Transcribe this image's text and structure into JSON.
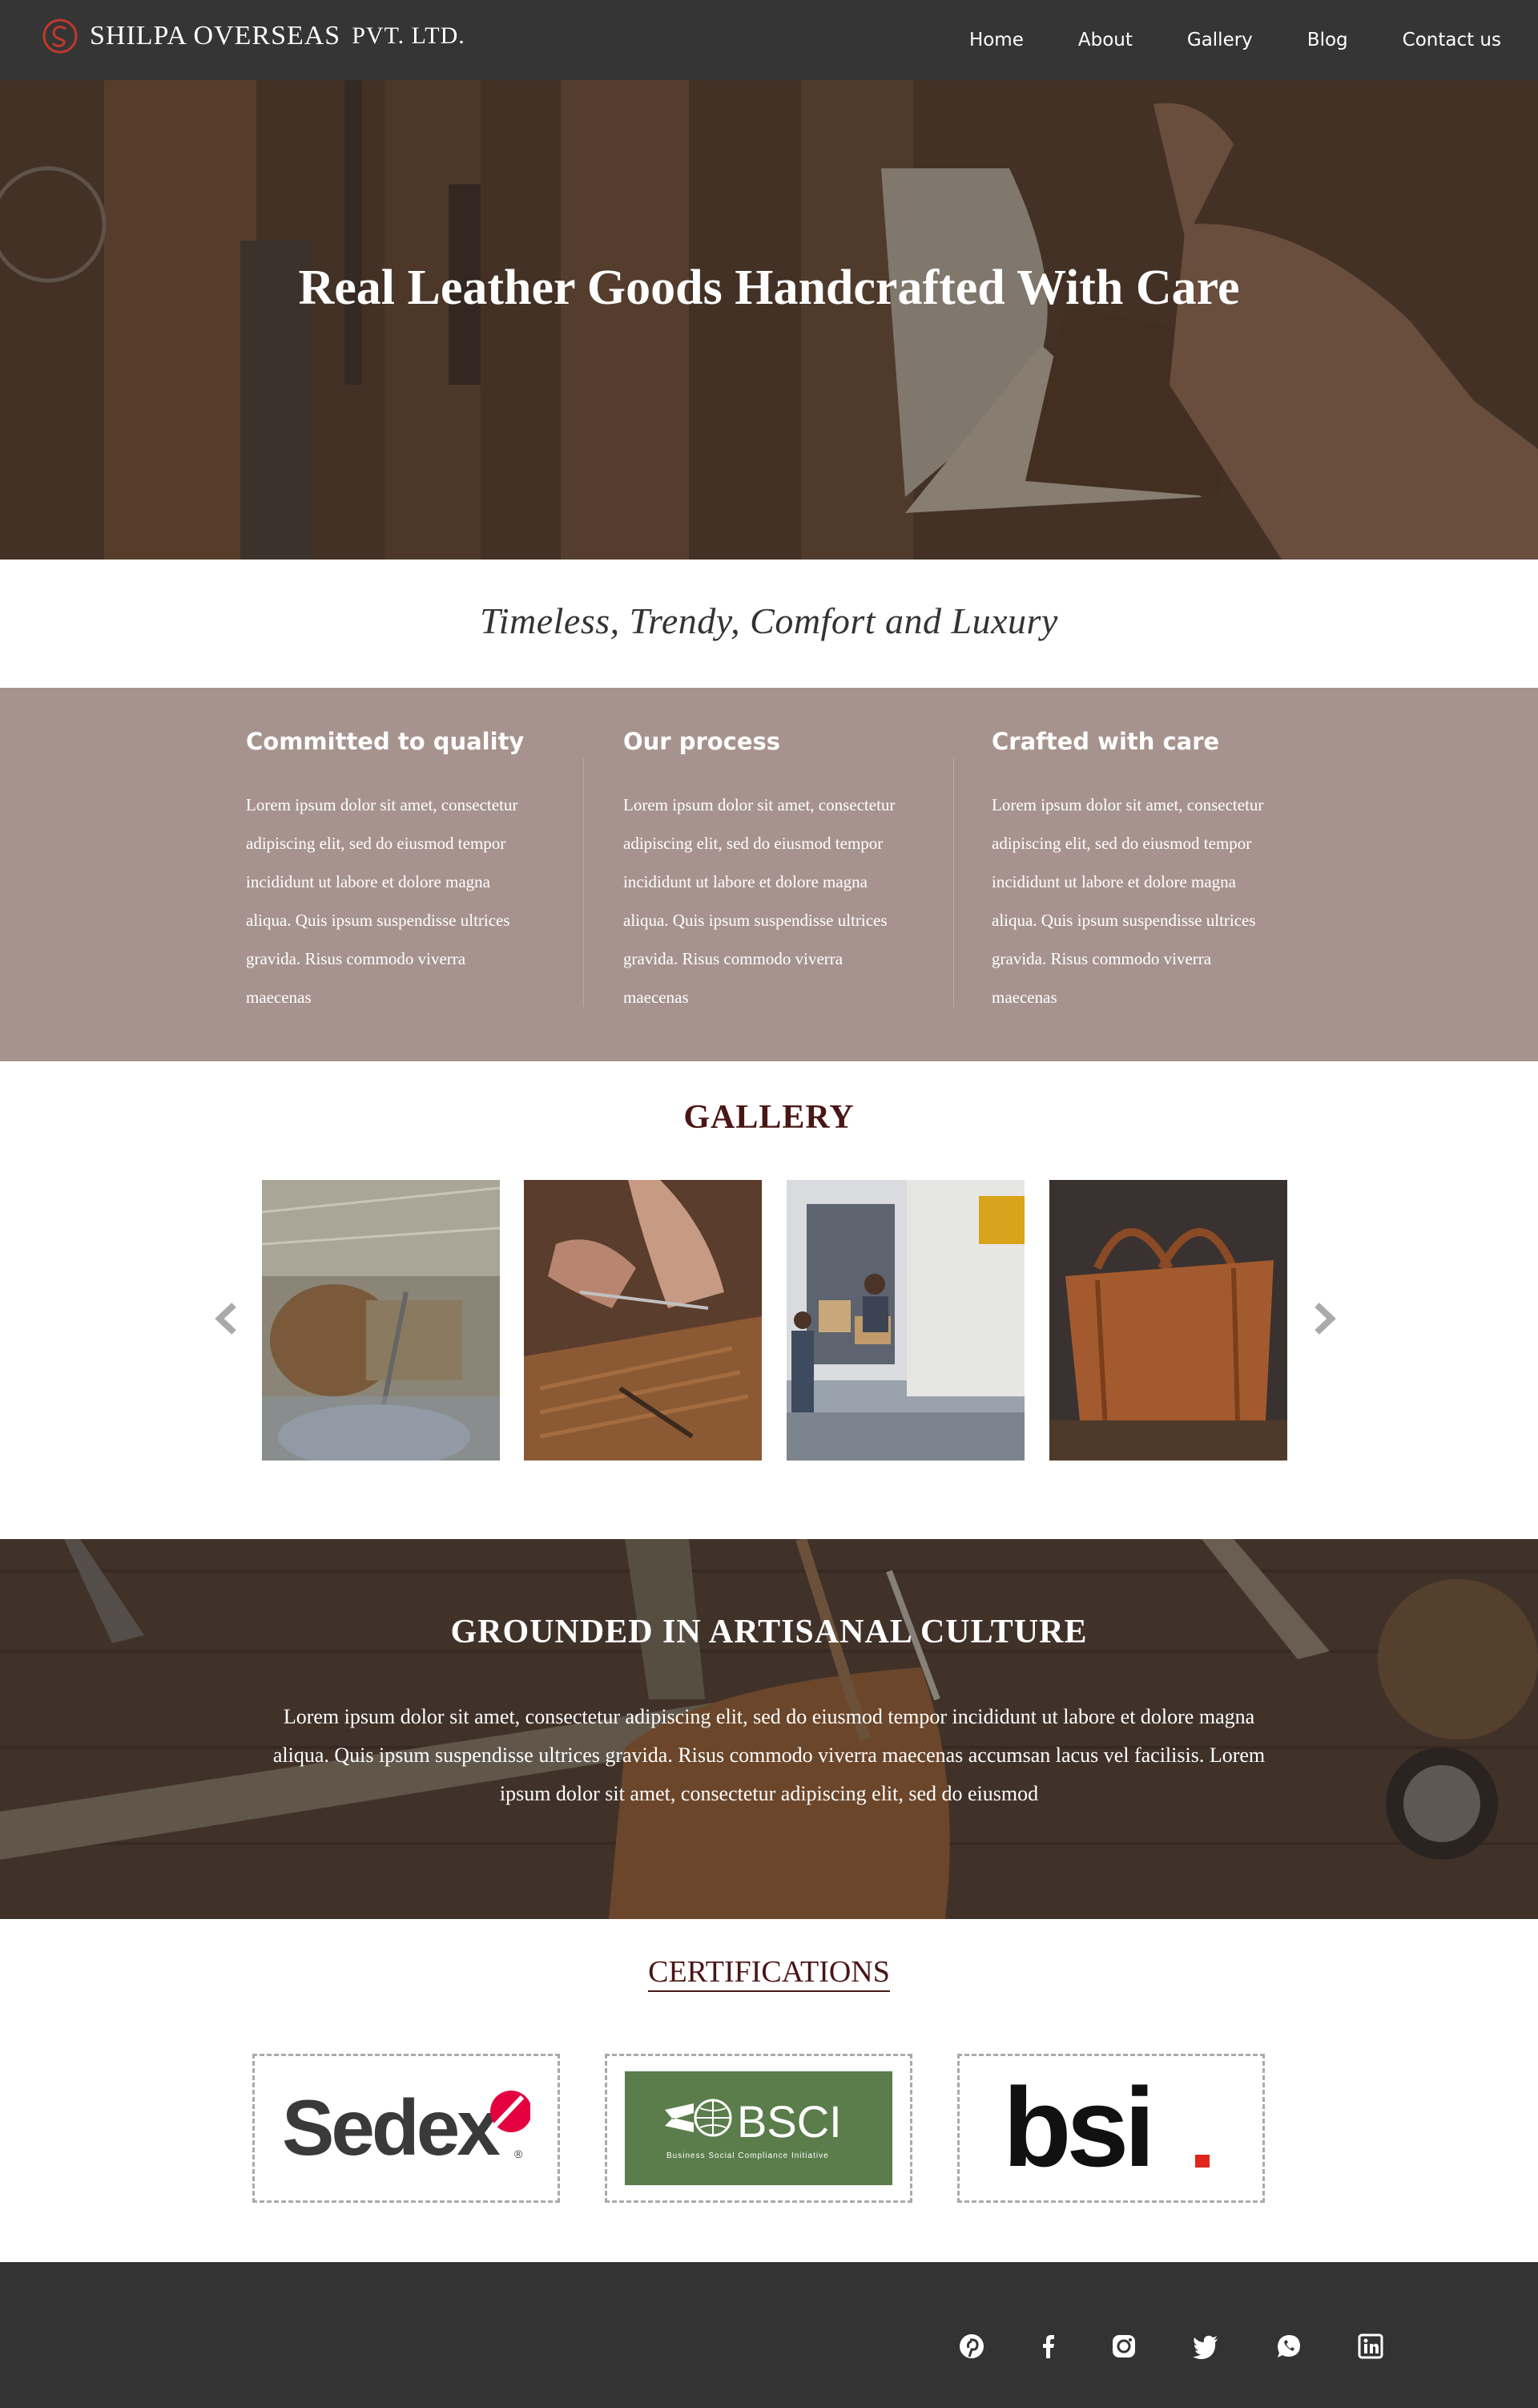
{
  "header": {
    "brand_name": "SHILPA OVERSEAS",
    "brand_suffix": "PVT. LTD.",
    "nav": [
      "Home",
      "About",
      "Gallery",
      "Blog",
      "Contact us"
    ]
  },
  "hero": {
    "title": "Real Leather Goods Handcrafted With Care"
  },
  "tagline": "Timeless, Trendy, Comfort and Luxury",
  "features": [
    {
      "title": "Committed to quality",
      "body": "Lorem ipsum dolor sit amet, consectetur adipiscing elit, sed do eiusmod tempor incididunt ut labore et dolore magna aliqua. Quis ipsum suspendisse ultrices gravida. Risus commodo viverra maecenas"
    },
    {
      "title": "Our process",
      "body": "Lorem ipsum dolor sit amet, consectetur adipiscing elit, sed do eiusmod tempor incididunt ut labore et dolore magna aliqua. Quis ipsum suspendisse ultrices gravida. Risus commodo viverra maecenas"
    },
    {
      "title": "Crafted with care",
      "body": "Lorem ipsum dolor sit amet, consectetur adipiscing elit, sed do eiusmod tempor incididunt ut labore et dolore magna aliqua. Quis ipsum suspendisse ultrices gravida. Risus commodo viverra maecenas"
    }
  ],
  "gallery": {
    "title": "GALLERY",
    "prev_icon": "chevron-left-icon",
    "next_icon": "chevron-right-icon",
    "images": [
      "factory-machinery-image",
      "leather-cutting-image",
      "delivery-truck-image",
      "leather-handbag-image"
    ]
  },
  "artisanal": {
    "title": "GROUNDED IN ARTISANAL CULTURE",
    "body": "Lorem ipsum dolor sit amet, consectetur adipiscing elit, sed do eiusmod tempor incididunt ut labore et dolore magna aliqua. Quis ipsum suspendisse ultrices gravida. Risus commodo viverra maecenas accumsan lacus vel facilisis. Lorem ipsum dolor sit amet, consectetur adipiscing elit, sed do eiusmod"
  },
  "certifications": {
    "title": "CERTIFICATIONS",
    "logos": [
      {
        "name": "sedex",
        "text": "Sedex",
        "mark": "®"
      },
      {
        "name": "bsci",
        "text": "BSCI",
        "subtext": "Business Social Compliance Initiative"
      },
      {
        "name": "bsi",
        "text": "bsi"
      }
    ]
  },
  "footer": {
    "social": [
      "pinterest-icon",
      "facebook-icon",
      "instagram-icon",
      "twitter-icon",
      "whatsapp-icon",
      "linkedin-icon"
    ]
  },
  "colors": {
    "nav_bg": "#353535",
    "features_bg": "#a7938d",
    "heading_maroon": "#4a1616",
    "footer_bg": "#333333",
    "brand_red": "#c0392b",
    "bsci_green": "#5a7d4b"
  }
}
